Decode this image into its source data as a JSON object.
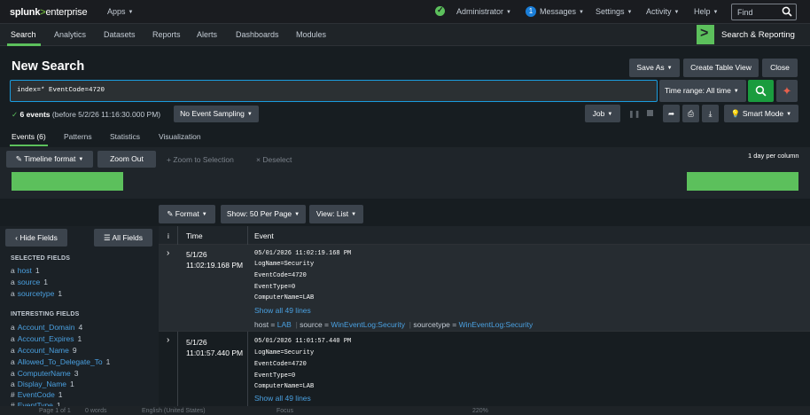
{
  "top_nav": {
    "logo_a": "splunk",
    "logo_b": ">",
    "logo_c": "enterprise",
    "apps": "Apps",
    "admin": "Administrator",
    "messages_count": "1",
    "messages": "Messages",
    "settings": "Settings",
    "activity": "Activity",
    "help": "Help",
    "find": "Find"
  },
  "sub_nav": {
    "items": [
      "Search",
      "Analytics",
      "Datasets",
      "Reports",
      "Alerts",
      "Dashboards",
      "Modules"
    ],
    "app_title": "Search & Reporting"
  },
  "page": {
    "title": "New Search",
    "save_as": "Save As",
    "create_table": "Create Table View",
    "close": "Close"
  },
  "search": {
    "query": "index=* EventCode=4720",
    "time_range": "Time range: All time"
  },
  "status": {
    "count": "6 events",
    "before": "(before 5/2/26 11:16:30.000 PM)",
    "sampling": "No Event Sampling",
    "job": "Job",
    "smart_mode": "Smart Mode"
  },
  "tabs": [
    "Events (6)",
    "Patterns",
    "Statistics",
    "Visualization"
  ],
  "timeline": {
    "format": "Timeline format",
    "zoom_out": "Zoom Out",
    "zoom_selection": "+ Zoom to Selection",
    "deselect": "× Deselect",
    "scale": "1 day per column"
  },
  "events_toolbar": {
    "format": "Format",
    "per_page": "Show: 50 Per Page",
    "view": "View: List"
  },
  "fields": {
    "hide": "Hide Fields",
    "all": "All Fields",
    "selected_title": "SELECTED FIELDS",
    "selected": [
      {
        "prefix": "a",
        "name": "host",
        "count": "1"
      },
      {
        "prefix": "a",
        "name": "source",
        "count": "1"
      },
      {
        "prefix": "a",
        "name": "sourcetype",
        "count": "1"
      }
    ],
    "interesting_title": "INTERESTING FIELDS",
    "interesting": [
      {
        "prefix": "a",
        "name": "Account_Domain",
        "count": "4"
      },
      {
        "prefix": "a",
        "name": "Account_Expires",
        "count": "1"
      },
      {
        "prefix": "a",
        "name": "Account_Name",
        "count": "9"
      },
      {
        "prefix": "a",
        "name": "Allowed_To_Delegate_To",
        "count": "1"
      },
      {
        "prefix": "a",
        "name": "ComputerName",
        "count": "3"
      },
      {
        "prefix": "a",
        "name": "Display_Name",
        "count": "1"
      },
      {
        "prefix": "#",
        "name": "EventCode",
        "count": "1"
      },
      {
        "prefix": "#",
        "name": "EventType",
        "count": "1"
      }
    ]
  },
  "table": {
    "col_i": "i",
    "col_time": "Time",
    "col_event": "Event"
  },
  "events": [
    {
      "date": "5/1/26",
      "time": "11:02:19.168 PM",
      "lines": [
        "05/01/2026 11:02:19.168 PM",
        "LogName=Security",
        "EventCode=4720",
        "EventType=0",
        "ComputerName=LAB"
      ],
      "show_all": "Show all 49 lines",
      "meta": {
        "host_label": "host =",
        "host": "LAB",
        "source_label": "source =",
        "source": "WinEventLog:Security",
        "st_label": "sourcetype =",
        "sourcetype": "WinEventLog:Security"
      }
    },
    {
      "date": "5/1/26",
      "time": "11:01:57.440 PM",
      "lines": [
        "05/01/2026 11:01:57.440 PM",
        "LogName=Security",
        "EventCode=4720",
        "EventType=0",
        "ComputerName=LAB"
      ],
      "show_all": "Show all 49 lines"
    }
  ],
  "statusbar": {
    "page": "Page 1 of 1",
    "words": "0 words",
    "lang": "English (United States)",
    "focus": "Focus",
    "zoom": "220%"
  }
}
